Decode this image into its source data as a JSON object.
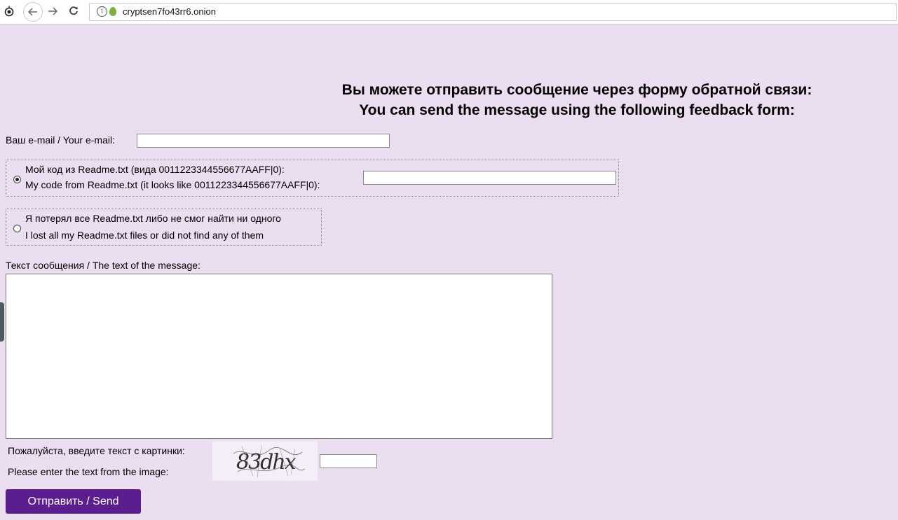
{
  "browser": {
    "url": "cryptsen7fo43rr6.onion",
    "icons": {
      "tor": "onion-browser-icon",
      "back": "back-arrow-icon",
      "forward": "forward-arrow-icon",
      "reload": "reload-icon",
      "info": "info-icon",
      "site": "onion-site-icon"
    }
  },
  "heading": {
    "line_ru": "Вы можете отправить сообщение через форму обратной связи:",
    "line_en": "You can send the message using the following feedback form:"
  },
  "form": {
    "email_label": "Ваш e-mail / Your e-mail:",
    "email_value": "",
    "option_code": {
      "line_ru": "Мой код из Readme.txt (вида 0011223344556677AAFF|0):",
      "line_en": "My code from Readme.txt (it looks like 0011223344556677AAFF|0):",
      "selected": true,
      "value": ""
    },
    "option_lost": {
      "line_ru": "Я потерял все Readme.txt либо не смог найти ни одного",
      "line_en": "I lost all my Readme.txt files or did not find any of them",
      "selected": false
    },
    "message_label": "Текст сообщения / The text of the message:",
    "message_value": "",
    "captcha_label_ru": "Пожалуйста, введите текст с картинки:",
    "captcha_label_en": "Please enter the text from the image:",
    "captcha_image_text": "83dhx",
    "captcha_value": "",
    "submit_label": "Отправить / Send"
  },
  "colors": {
    "page_background": "#ebdef0",
    "submit_background": "#5c1d8f",
    "captcha_background": "#f4eef8"
  }
}
